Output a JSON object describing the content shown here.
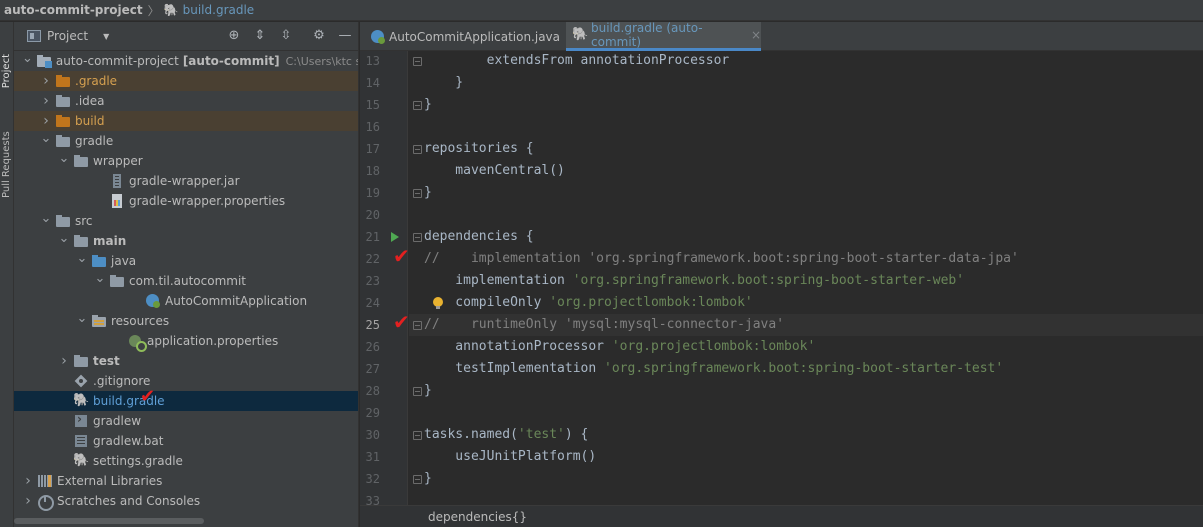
{
  "breadcrumb": {
    "project": "auto-commit-project",
    "separator": "〉",
    "file": "build.gradle"
  },
  "toolstrip": {
    "project_label": "Project",
    "pull_requests_label": "Pull Requests"
  },
  "project_panel": {
    "title": "Project",
    "tree": [
      {
        "label": "auto-commit-project",
        "extra": "[auto-commit]",
        "path": "C:\\Users\\ktc syst",
        "icon": "project-folder-icon",
        "arrow": "down"
      },
      {
        "label": ".gradle",
        "icon": "folder-orange-icon",
        "arrow": "right"
      },
      {
        "label": ".idea",
        "icon": "folder-icon",
        "arrow": "right"
      },
      {
        "label": "build",
        "icon": "folder-orange-icon",
        "arrow": "right"
      },
      {
        "label": "gradle",
        "icon": "folder-icon",
        "arrow": "down"
      },
      {
        "label": "wrapper",
        "icon": "folder-icon",
        "arrow": "down"
      },
      {
        "label": "gradle-wrapper.jar",
        "icon": "jar-icon",
        "arrow": ""
      },
      {
        "label": "gradle-wrapper.properties",
        "icon": "properties-icon",
        "arrow": ""
      },
      {
        "label": "src",
        "icon": "folder-icon",
        "arrow": "down"
      },
      {
        "label": "main",
        "icon": "folder-icon",
        "arrow": "down"
      },
      {
        "label": "java",
        "icon": "folder-blue-icon",
        "arrow": "down"
      },
      {
        "label": "com.til.autocommit",
        "icon": "package-icon",
        "arrow": "down"
      },
      {
        "label": "AutoCommitApplication",
        "icon": "java-class-icon",
        "arrow": ""
      },
      {
        "label": "resources",
        "icon": "resources-folder-icon",
        "arrow": "down"
      },
      {
        "label": "application.properties",
        "icon": "spring-properties-icon",
        "arrow": ""
      },
      {
        "label": "test",
        "icon": "folder-icon",
        "arrow": "right"
      },
      {
        "label": ".gitignore",
        "icon": "gitignore-icon",
        "arrow": ""
      },
      {
        "label": "build.gradle",
        "icon": "gradle-elephant-icon",
        "arrow": ""
      },
      {
        "label": "gradlew",
        "icon": "shell-script-icon",
        "arrow": ""
      },
      {
        "label": "gradlew.bat",
        "icon": "batch-file-icon",
        "arrow": ""
      },
      {
        "label": "settings.gradle",
        "icon": "gradle-elephant-icon",
        "arrow": ""
      },
      {
        "label": "External Libraries",
        "icon": "libraries-icon",
        "arrow": "right"
      },
      {
        "label": "Scratches and Consoles",
        "icon": "scratches-icon",
        "arrow": "right"
      }
    ]
  },
  "editor": {
    "tabs": [
      {
        "label": "AutoCommitApplication.java",
        "active": false
      },
      {
        "label": "build.gradle (auto-commit)",
        "active": true,
        "close": "×"
      }
    ],
    "lines": [
      {
        "n": "13",
        "parts": [
          [
            "plain",
            "        extendsFrom annotationProcessor"
          ]
        ]
      },
      {
        "n": "14",
        "parts": [
          [
            "plain",
            "    }"
          ]
        ]
      },
      {
        "n": "15",
        "parts": [
          [
            "plain",
            "}"
          ]
        ]
      },
      {
        "n": "16",
        "parts": [
          [
            "plain",
            ""
          ]
        ]
      },
      {
        "n": "17",
        "parts": [
          [
            "plain",
            "repositories {"
          ]
        ]
      },
      {
        "n": "18",
        "parts": [
          [
            "plain",
            "    mavenCentral()"
          ]
        ]
      },
      {
        "n": "19",
        "parts": [
          [
            "plain",
            "}"
          ]
        ]
      },
      {
        "n": "20",
        "parts": [
          [
            "plain",
            ""
          ]
        ]
      },
      {
        "n": "21",
        "parts": [
          [
            "plain",
            "dependencies {"
          ]
        ]
      },
      {
        "n": "22",
        "parts": [
          [
            "cmt",
            "//    implementation 'org.springframework.boot:spring-boot-starter-data-jpa'"
          ]
        ]
      },
      {
        "n": "23",
        "parts": [
          [
            "plain",
            "    implementation "
          ],
          [
            "str",
            "'org.springframework.boot:spring-boot-starter-web'"
          ]
        ]
      },
      {
        "n": "24",
        "parts": [
          [
            "plain",
            "    compileOnly "
          ],
          [
            "str",
            "'org.projectlombok:lombok'"
          ]
        ]
      },
      {
        "n": "25",
        "parts": [
          [
            "cmt",
            "//    runtimeOnly 'mysql:mysql-connector-java'"
          ]
        ]
      },
      {
        "n": "26",
        "parts": [
          [
            "plain",
            "    annotationProcessor "
          ],
          [
            "str",
            "'org.projectlombok:lombok'"
          ]
        ]
      },
      {
        "n": "27",
        "parts": [
          [
            "plain",
            "    testImplementation "
          ],
          [
            "str",
            "'org.springframework.boot:spring-boot-starter-test'"
          ]
        ]
      },
      {
        "n": "28",
        "parts": [
          [
            "plain",
            "}"
          ]
        ]
      },
      {
        "n": "29",
        "parts": [
          [
            "plain",
            ""
          ]
        ]
      },
      {
        "n": "30",
        "parts": [
          [
            "plain",
            "tasks.named("
          ],
          [
            "str",
            "'test'"
          ],
          [
            "plain",
            ") {"
          ]
        ]
      },
      {
        "n": "31",
        "parts": [
          [
            "plain",
            "    useJUnitPlatform()"
          ]
        ]
      },
      {
        "n": "32",
        "parts": [
          [
            "plain",
            "}"
          ]
        ]
      },
      {
        "n": "33",
        "parts": [
          [
            "plain",
            ""
          ]
        ]
      }
    ],
    "current_line": "25",
    "status_crumb": "dependencies{}"
  },
  "colors": {
    "accent": "#4a88c7",
    "comment": "#808080",
    "string": "#6a8759",
    "annotation_check": "#e32020"
  }
}
